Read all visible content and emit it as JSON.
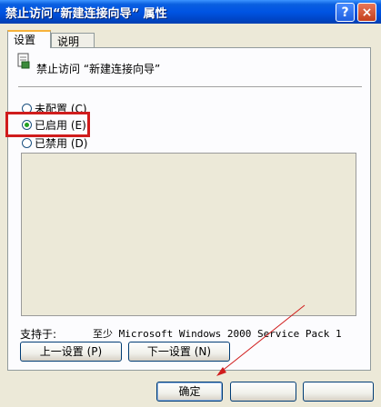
{
  "window": {
    "title": "禁止访问“新建连接向导” 属性",
    "help_glyph": "?",
    "close_glyph": "×"
  },
  "tabs": [
    {
      "label": "设置"
    },
    {
      "label": "说明"
    }
  ],
  "policy": {
    "name": "禁止访问 “新建连接向导”",
    "icon": "policy-document-icon"
  },
  "options": [
    {
      "label": "未配置 (C)",
      "selected": false
    },
    {
      "label": "已启用 (E)",
      "selected": true
    },
    {
      "label": "已禁用 (D)",
      "selected": false
    }
  ],
  "support": {
    "label": "支持于:",
    "value": "至少 Microsoft Windows 2000 Service Pack 1"
  },
  "nav_buttons": {
    "prev": "上一设置 (P)",
    "next": "下一设置 (N)"
  },
  "dialog_buttons": {
    "ok": "确定",
    "cancel": "",
    "apply": ""
  },
  "annotation_color": "#d01c1c"
}
